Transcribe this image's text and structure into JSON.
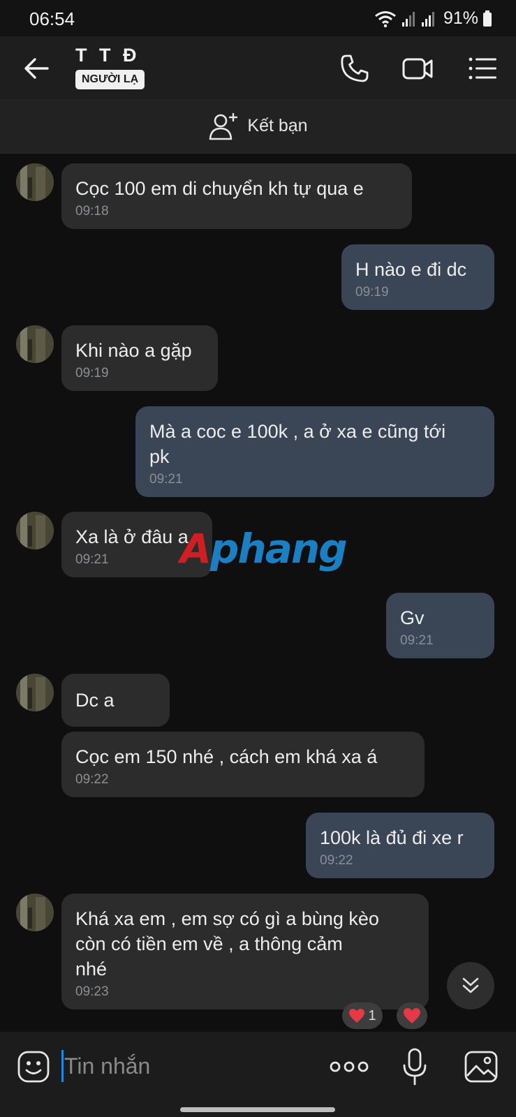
{
  "status_bar": {
    "time": "06:54",
    "battery": "91%",
    "icons": [
      "wifi-icon",
      "signal-icon",
      "signal-icon",
      "battery-icon"
    ]
  },
  "header": {
    "contact_name": "T T Đ",
    "badge": "NGƯỜI LẠ",
    "icons": [
      "back-arrow-icon",
      "phone-icon",
      "video-camera-icon",
      "list-menu-icon"
    ]
  },
  "add_friend": {
    "label": "Kết bạn",
    "icon": "add-person-icon"
  },
  "messages": [
    {
      "dir": "in",
      "text": "Cọc 100 em di chuyển kh tự qua e",
      "time": "09:18"
    },
    {
      "dir": "out",
      "text": "H nào e đi dc",
      "time": "09:19"
    },
    {
      "dir": "in",
      "text": "Khi nào a gặp",
      "time": "09:19"
    },
    {
      "dir": "out",
      "text": "Mà a coc e 100k , a ở xa e cũng tới\npk",
      "time": "09:21"
    },
    {
      "dir": "in",
      "text": "Xa là ở đâu a",
      "time": "09:21"
    },
    {
      "dir": "out",
      "text": "Gv",
      "time": "09:21"
    },
    {
      "dir": "in",
      "text": "Dc a",
      "time": ""
    },
    {
      "dir": "in",
      "text": "Cọc em 150 nhé , cách em khá xa á",
      "time": "09:22"
    },
    {
      "dir": "out",
      "text": "100k là đủ đi xe r",
      "time": "09:22"
    },
    {
      "dir": "in",
      "text": "Khá xa em , em sợ có gì a bùng kèo\ncòn có tiền em về , a thông cảm\nnhé",
      "time": "09:23"
    }
  ],
  "reactions": {
    "count": "1",
    "icon": "heart-icon"
  },
  "watermark": {
    "first": "A",
    "rest": "phang"
  },
  "composer": {
    "placeholder": "Tin nhắn",
    "icons": [
      "sticker-face-icon",
      "more-dots-icon",
      "microphone-icon",
      "image-icon"
    ]
  },
  "colors": {
    "background": "#0f0f0f",
    "incoming_bubble": "#2c2c2c",
    "outgoing_bubble": "#3a4555",
    "accent": "#1e88e5",
    "heart": "#e53945"
  }
}
